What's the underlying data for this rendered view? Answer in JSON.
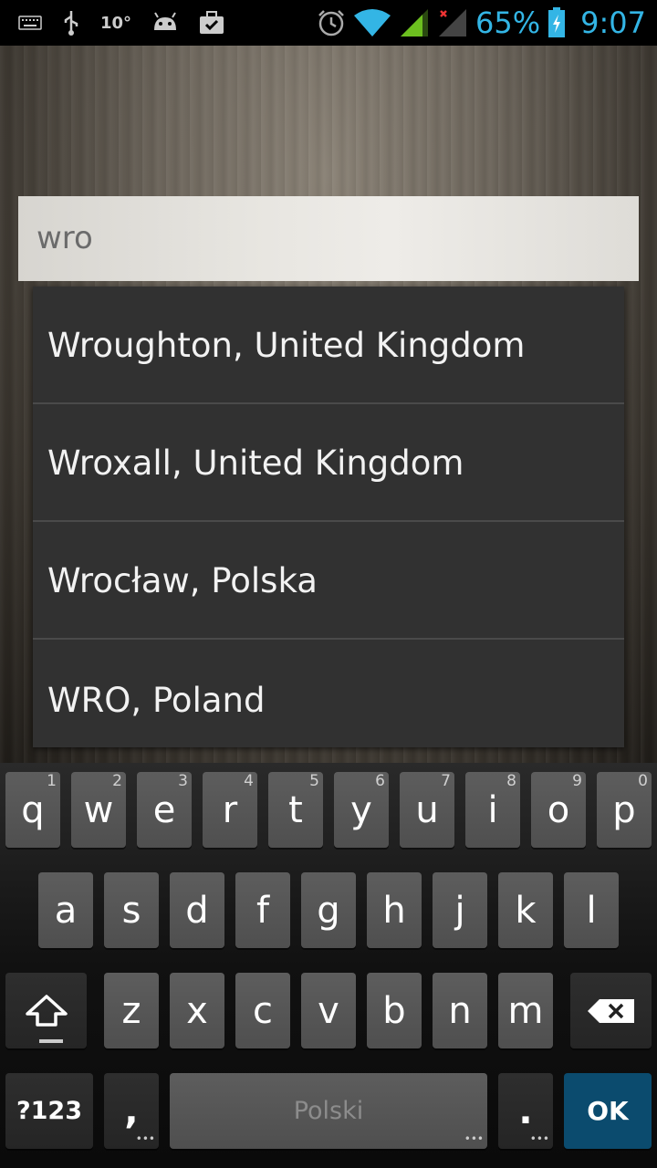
{
  "status_bar": {
    "temperature": "10°",
    "battery_percent": "65%",
    "time": "9:07"
  },
  "search": {
    "value": "wro"
  },
  "suggestions": [
    "Wroughton, United Kingdom",
    "Wroxall, United Kingdom",
    "Wrocław, Polska",
    "WRO, Poland"
  ],
  "keyboard": {
    "row1": [
      {
        "label": "q",
        "hint": "1"
      },
      {
        "label": "w",
        "hint": "2"
      },
      {
        "label": "e",
        "hint": "3"
      },
      {
        "label": "r",
        "hint": "4"
      },
      {
        "label": "t",
        "hint": "5"
      },
      {
        "label": "y",
        "hint": "6"
      },
      {
        "label": "u",
        "hint": "7"
      },
      {
        "label": "i",
        "hint": "8"
      },
      {
        "label": "o",
        "hint": "9"
      },
      {
        "label": "p",
        "hint": "0"
      }
    ],
    "row2": [
      "a",
      "s",
      "d",
      "f",
      "g",
      "h",
      "j",
      "k",
      "l"
    ],
    "row3": [
      "z",
      "x",
      "c",
      "v",
      "b",
      "n",
      "m"
    ],
    "symbols_label": "?123",
    "comma_label": ",",
    "space_label": "Polski",
    "period_label": ".",
    "ok_label": "OK",
    "colors": {
      "ok_key": "#0b4b6e",
      "accent": "#33b5e5"
    }
  }
}
